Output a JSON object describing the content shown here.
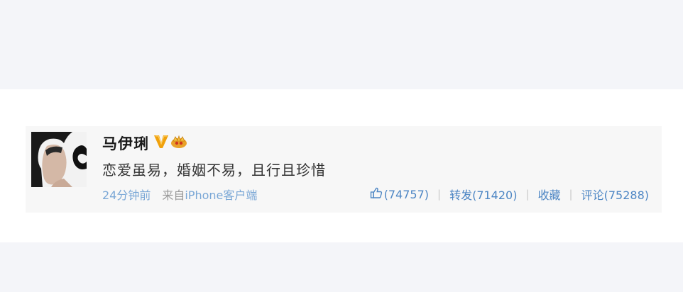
{
  "post": {
    "username": "马伊琍",
    "content": "恋爱虽易，婚姻不易，且行且珍惜",
    "time": "24分钟前",
    "from_label": "来自",
    "device": "iPhone客户端"
  },
  "actions": {
    "like_count": "(74757)",
    "repost_label": "转发(71420)",
    "favorite_label": "收藏",
    "comment_label": "评论(75288)"
  },
  "icons": {
    "verified": "verified-v-icon",
    "crown": "vip-crown-icon",
    "like": "thumbs-up-icon"
  },
  "colors": {
    "link": "#4d86c4",
    "meta": "#7aa7d6",
    "verified": "#f0a10c"
  }
}
